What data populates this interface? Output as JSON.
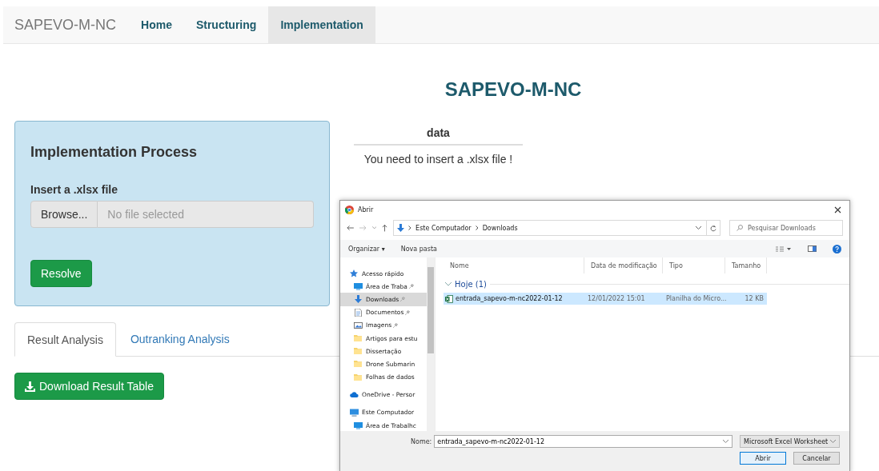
{
  "navbar": {
    "brand": "SAPEVO-M-NC",
    "items": [
      {
        "label": "Home",
        "selected": false
      },
      {
        "label": "Structuring",
        "selected": false
      },
      {
        "label": "Implementation",
        "selected": true
      }
    ]
  },
  "page_title": "SAPEVO-M-NC",
  "panel": {
    "title": "Implementation Process",
    "file_label": "Insert a .xlsx file",
    "browse_button": "Browse...",
    "file_placeholder": "No file selected",
    "resolve_button": "Resolve"
  },
  "data_table": {
    "header": "data",
    "message": "You need to insert a .xlsx file !"
  },
  "tabs": [
    {
      "label": "Result Analysis",
      "selected": true
    },
    {
      "label": "Outranking Analysis",
      "selected": false
    }
  ],
  "download_button": "Download Result Table",
  "dialog": {
    "title": "Abrir",
    "breadcrumb": [
      "Este Computador",
      "Downloads"
    ],
    "search_placeholder": "Pesquisar Downloads",
    "toolbar": [
      "Organizar ▾",
      "Nova pasta"
    ],
    "sidebar": [
      {
        "label": "Acesso rápido",
        "kind": "star",
        "pinned": false,
        "selected": false,
        "children": [
          {
            "label": "Área de Traba",
            "kind": "desktop",
            "pinned": true,
            "selected": false
          },
          {
            "label": "Downloads",
            "kind": "download",
            "pinned": true,
            "selected": true
          },
          {
            "label": "Documentos",
            "kind": "document",
            "pinned": true,
            "selected": false
          },
          {
            "label": "Imagens",
            "kind": "image",
            "pinned": true,
            "selected": false
          },
          {
            "label": "Artigos para estu",
            "kind": "folder",
            "pinned": false,
            "selected": false
          },
          {
            "label": "Dissertação",
            "kind": "folder",
            "pinned": false,
            "selected": false
          },
          {
            "label": "Drone Submarin",
            "kind": "folder",
            "pinned": false,
            "selected": false
          },
          {
            "label": "Folhas de dados",
            "kind": "folder",
            "pinned": false,
            "selected": false
          }
        ]
      },
      {
        "label": "OneDrive - Persor",
        "kind": "cloud",
        "pinned": false,
        "selected": false
      },
      {
        "label": "Este Computador",
        "kind": "computer",
        "pinned": false,
        "selected": false,
        "children": [
          {
            "label": "Área de Trabalhc",
            "kind": "desktop",
            "pinned": false,
            "selected": false
          }
        ]
      }
    ],
    "columns": [
      "Nome",
      "Data de modificação",
      "Tipo",
      "Tamanho"
    ],
    "groups": [
      {
        "label": "Hoje (1)",
        "expanded": true,
        "files": [
          {
            "name": "entrada_sapevo-m-nc2022-01-12",
            "date": "12/01/2022 15:01",
            "type": "Planilha do Micro...",
            "size": "12 KB",
            "selected": true
          }
        ]
      }
    ],
    "filename_label": "Nome:",
    "filename_value": "entrada_sapevo-m-nc2022-01-12",
    "filetype": "Microsoft Excel Worksheet",
    "buttons": [
      {
        "label": "Abrir",
        "kind": "default"
      },
      {
        "label": "Cancelar",
        "kind": "normal"
      }
    ]
  }
}
